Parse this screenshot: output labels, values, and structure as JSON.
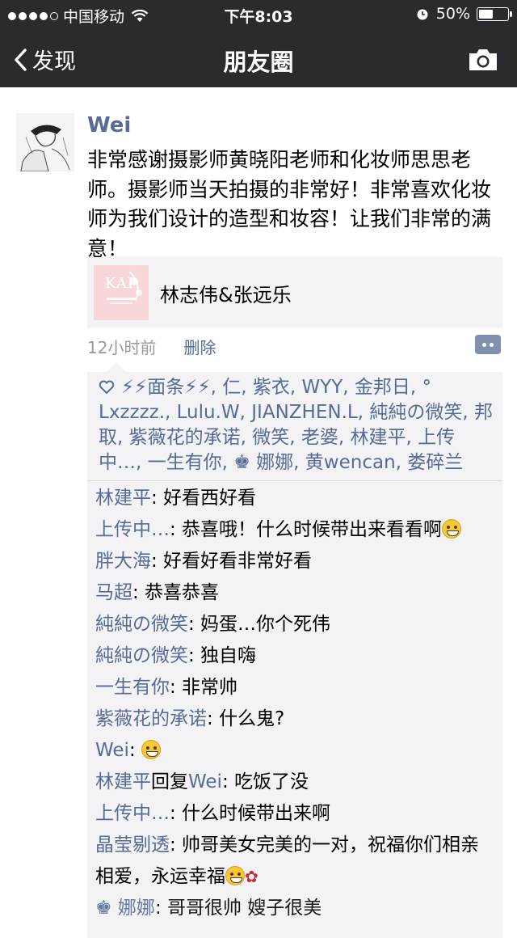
{
  "status_bar": {
    "carrier": "中国移动",
    "time": "下午8:03",
    "battery": "50%",
    "battery_level": 0.5
  },
  "nav": {
    "back_label": "发现",
    "title": "朋友圈",
    "camera_icon": "camera-icon"
  },
  "post": {
    "author": "Wei",
    "text": "非常感谢摄影师黄晓阳老师和化妆师思思老师。摄影师当天拍摄的非常好！非常喜欢化妆师为我们设计的造型和妆容！让我们非常的满意！",
    "share": {
      "thumb_text": "KAI",
      "title": "林志伟&张远乐"
    },
    "time_ago": "12小时前",
    "delete_label": "删除"
  },
  "likes": {
    "names": "⚡⚡面条⚡⚡, 仁, 紫衣, WYY, 金邦日, ° Lxzzzz., Lulu.W, JIANZHEN.L, 純純の微笑, 邦取, 紫薇花的承诺, 微笑, 老婆, 林建平, 上传中…, 一生有你, ♚ 娜娜, 黄wencan, 娄碎兰"
  },
  "comments": [
    {
      "name": "林建平",
      "text": ": 好看西好看",
      "emoji": ""
    },
    {
      "name": "上传中…",
      "text": ": 恭喜哦！什么时候带出来看看啊",
      "emoji": "grin"
    },
    {
      "name": "胖大海",
      "text": ": 好看好看非常好看",
      "emoji": ""
    },
    {
      "name": "马超",
      "text": ": 恭喜恭喜",
      "emoji": ""
    },
    {
      "name": "純純の微笑",
      "text": ": 妈蛋…你个死伟",
      "emoji": ""
    },
    {
      "name": "純純の微笑",
      "text": ": 独自嗨",
      "emoji": ""
    },
    {
      "name": "一生有你",
      "text": ": 非常帅",
      "emoji": ""
    },
    {
      "name": "紫薇花的承诺",
      "text": ": 什么鬼?",
      "emoji": ""
    },
    {
      "name": "Wei",
      "text": ": ",
      "emoji": "grin"
    },
    {
      "name": "林建平",
      "reply_word": "回复",
      "reply_to": "Wei",
      "text": ": 吃饭了没",
      "emoji": ""
    },
    {
      "name": "上传中…",
      "text": ": 什么时候带出来啊",
      "emoji": ""
    },
    {
      "name": "晶莹剔透",
      "text": ": 帅哥美女完美的一对，祝福你们相亲相爱，永运幸福",
      "emoji": "blush-rose"
    },
    {
      "name": "♚ 娜娜",
      "text": ": 哥哥很帅 嫂子很美",
      "emoji": ""
    }
  ],
  "colors": {
    "nav_bg": "#2b2b2f",
    "link": "#576b95",
    "feedback_bg": "#f3f3f5"
  }
}
